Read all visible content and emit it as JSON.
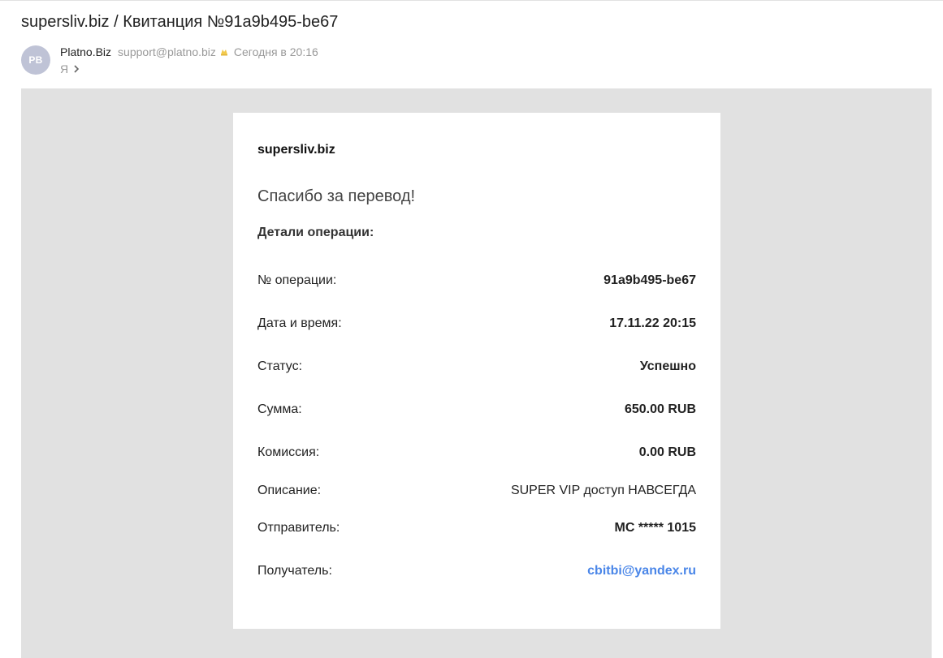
{
  "subject": "supersliv.biz / Квитанция №91a9b495-be67",
  "sender": {
    "avatar_initials": "PB",
    "name": "Platno.Biz",
    "email": "support@platno.biz",
    "time": "Сегодня в 20:16",
    "recipient": "Я",
    "verified_icon": "verified-badge-icon",
    "chevron_icon": "chevron-right-icon"
  },
  "colors": {
    "link": "#4a86e8",
    "avatar_bg": "#bfc3d6",
    "body_bg": "#e1e1e1",
    "verified_icon": "#f2c94c"
  },
  "receipt": {
    "brand": "supersliv.biz",
    "thanks": "Спасибо за перевод!",
    "details_title": "Детали операции:",
    "rows": [
      {
        "label": "№ операции:",
        "value": "91a9b495-be67"
      },
      {
        "label": "Дата и время:",
        "value": "17.11.22 20:15"
      },
      {
        "label": "Статус:",
        "value": "Успешно"
      },
      {
        "label": "Сумма:",
        "value": "650.00 RUB"
      },
      {
        "label": "Комиссия:",
        "value": "0.00 RUB"
      },
      {
        "label": "Описание:",
        "value": "SUPER VIP доступ НАВСЕГДА"
      },
      {
        "label": "Отправитель:",
        "value": "MC ***** 1015"
      },
      {
        "label": "Получатель:",
        "value": "cbitbi@yandex.ru"
      }
    ]
  }
}
